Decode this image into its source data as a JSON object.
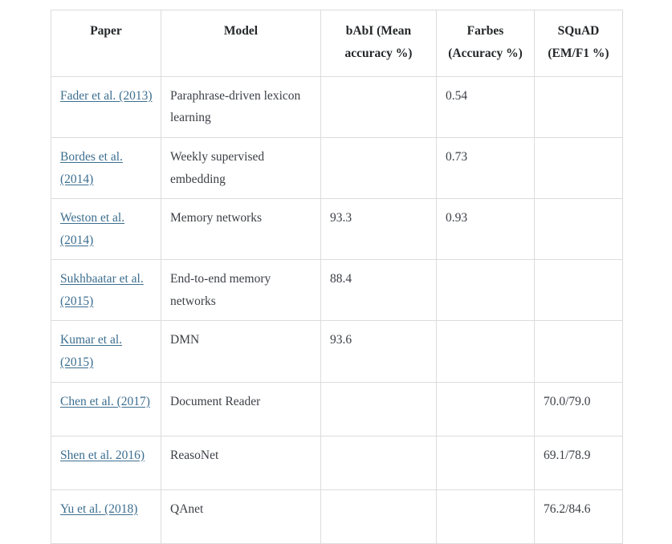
{
  "table": {
    "columns": [
      {
        "key": "paper",
        "label": "Paper"
      },
      {
        "key": "model",
        "label": "Model"
      },
      {
        "key": "babi",
        "label": "bAbI (Mean accuracy %)"
      },
      {
        "key": "farbes",
        "label": "Farbes (Accuracy %)"
      },
      {
        "key": "squad",
        "label": "SQuAD (EM/F1 %)"
      }
    ],
    "rows": [
      {
        "paper": "Fader et al. (2013)",
        "model": "Paraphrase-driven lexicon learning",
        "babi": "",
        "farbes": "0.54",
        "squad": ""
      },
      {
        "paper": "Bordes et al. (2014)",
        "model": "Weekly supervised embedding",
        "babi": "",
        "farbes": "0.73",
        "squad": ""
      },
      {
        "paper": "Weston et al. (2014)",
        "model": "Memory networks",
        "babi": "93.3",
        "farbes": "0.93",
        "squad": ""
      },
      {
        "paper": "Sukhbaatar et al. (2015)",
        "model": "End-to-end memory networks",
        "babi": "88.4",
        "farbes": "",
        "squad": ""
      },
      {
        "paper": "Kumar et al. (2015)",
        "model": "DMN",
        "babi": "93.6",
        "farbes": "",
        "squad": ""
      },
      {
        "paper": "Chen et al. (2017)",
        "model": "Document Reader",
        "babi": "",
        "farbes": "",
        "squad": "70.0/79.0"
      },
      {
        "paper": "Shen et al. 2016)",
        "model": "ReasoNet",
        "babi": "",
        "farbes": "",
        "squad": "69.1/78.9"
      },
      {
        "paper": "Yu et al. (2018)",
        "model": "QAnet",
        "babi": "",
        "farbes": "",
        "squad": "76.2/84.6"
      }
    ]
  },
  "colors": {
    "link": "#3c6e8f",
    "border": "#dcdcdc",
    "header_text": "#242729",
    "body_text": "#3b3f45",
    "background": "#ffffff"
  }
}
